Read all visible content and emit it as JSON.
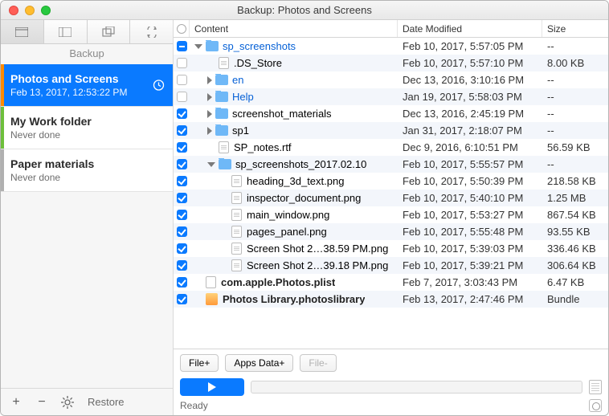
{
  "window": {
    "title": "Backup: Photos and Screens"
  },
  "sidebar": {
    "label": "Backup",
    "tasks": [
      {
        "title": "Photos and Screens",
        "sub": "Feb 13, 2017, 12:53:22 PM"
      },
      {
        "title": "My Work folder",
        "sub": "Never done"
      },
      {
        "title": "Paper materials",
        "sub": "Never done"
      }
    ],
    "footer": {
      "restore": "Restore"
    }
  },
  "columns": {
    "content": "Content",
    "date": "Date Modified",
    "size": "Size"
  },
  "rows": [
    {
      "check": "mixed",
      "indent": 0,
      "expand": "open",
      "icon": "folder",
      "name": "sp_screenshots",
      "link": true,
      "bold": false,
      "date": "Feb 10, 2017, 5:57:05 PM",
      "size": "--"
    },
    {
      "check": "off",
      "indent": 1,
      "expand": "none",
      "icon": "file",
      "name": ".DS_Store",
      "link": false,
      "bold": false,
      "date": "Feb 10, 2017, 5:57:10 PM",
      "size": "8.00 KB"
    },
    {
      "check": "off",
      "indent": 1,
      "expand": "closed",
      "icon": "folder",
      "name": "en",
      "link": true,
      "bold": false,
      "date": "Dec 13, 2016, 3:10:16 PM",
      "size": "--"
    },
    {
      "check": "off",
      "indent": 1,
      "expand": "closed",
      "icon": "folder",
      "name": "Help",
      "link": true,
      "bold": false,
      "date": "Jan 19, 2017, 5:58:03 PM",
      "size": "--"
    },
    {
      "check": "on",
      "indent": 1,
      "expand": "closed",
      "icon": "folder",
      "name": "screenshot_materials",
      "link": false,
      "bold": false,
      "date": "Dec 13, 2016, 2:45:19 PM",
      "size": "--"
    },
    {
      "check": "on",
      "indent": 1,
      "expand": "closed",
      "icon": "folder",
      "name": "sp1",
      "link": false,
      "bold": false,
      "date": "Jan 31, 2017, 2:18:07 PM",
      "size": "--"
    },
    {
      "check": "on",
      "indent": 1,
      "expand": "none",
      "icon": "file",
      "name": "SP_notes.rtf",
      "link": false,
      "bold": false,
      "date": "Dec 9, 2016, 6:10:51 PM",
      "size": "56.59 KB"
    },
    {
      "check": "on",
      "indent": 1,
      "expand": "open",
      "icon": "folder",
      "name": "sp_screenshots_2017.02.10",
      "link": false,
      "bold": false,
      "date": "Feb 10, 2017, 5:55:57 PM",
      "size": "--"
    },
    {
      "check": "on",
      "indent": 2,
      "expand": "none",
      "icon": "file",
      "name": "heading_3d_text.png",
      "link": false,
      "bold": false,
      "date": "Feb 10, 2017, 5:50:39 PM",
      "size": "218.58 KB"
    },
    {
      "check": "on",
      "indent": 2,
      "expand": "none",
      "icon": "file",
      "name": "inspector_document.png",
      "link": false,
      "bold": false,
      "date": "Feb 10, 2017, 5:40:10 PM",
      "size": "1.25 MB"
    },
    {
      "check": "on",
      "indent": 2,
      "expand": "none",
      "icon": "file",
      "name": "main_window.png",
      "link": false,
      "bold": false,
      "date": "Feb 10, 2017, 5:53:27 PM",
      "size": "867.54 KB"
    },
    {
      "check": "on",
      "indent": 2,
      "expand": "none",
      "icon": "file",
      "name": "pages_panel.png",
      "link": false,
      "bold": false,
      "date": "Feb 10, 2017, 5:55:48 PM",
      "size": "93.55 KB"
    },
    {
      "check": "on",
      "indent": 2,
      "expand": "none",
      "icon": "file",
      "name": "Screen Shot 2…38.59 PM.png",
      "link": false,
      "bold": false,
      "date": "Feb 10, 2017, 5:39:03 PM",
      "size": "336.46 KB"
    },
    {
      "check": "on",
      "indent": 2,
      "expand": "none",
      "icon": "file",
      "name": "Screen Shot 2…39.18 PM.png",
      "link": false,
      "bold": false,
      "date": "Feb 10, 2017, 5:39:21 PM",
      "size": "306.64 KB"
    },
    {
      "check": "on",
      "indent": 0,
      "expand": "none",
      "icon": "plist",
      "name": "com.apple.Photos.plist",
      "link": false,
      "bold": true,
      "date": "Feb 7, 2017, 3:03:43 PM",
      "size": "6.47 KB"
    },
    {
      "check": "on",
      "indent": 0,
      "expand": "none",
      "icon": "lib",
      "name": "Photos Library.photoslibrary",
      "link": false,
      "bold": true,
      "date": "Feb 13, 2017, 2:47:46 PM",
      "size": "Bundle"
    }
  ],
  "bottom": {
    "buttons": {
      "fileplus": "File+",
      "appsdata": "Apps Data+",
      "fileminus": "File-"
    },
    "status": "Ready"
  }
}
